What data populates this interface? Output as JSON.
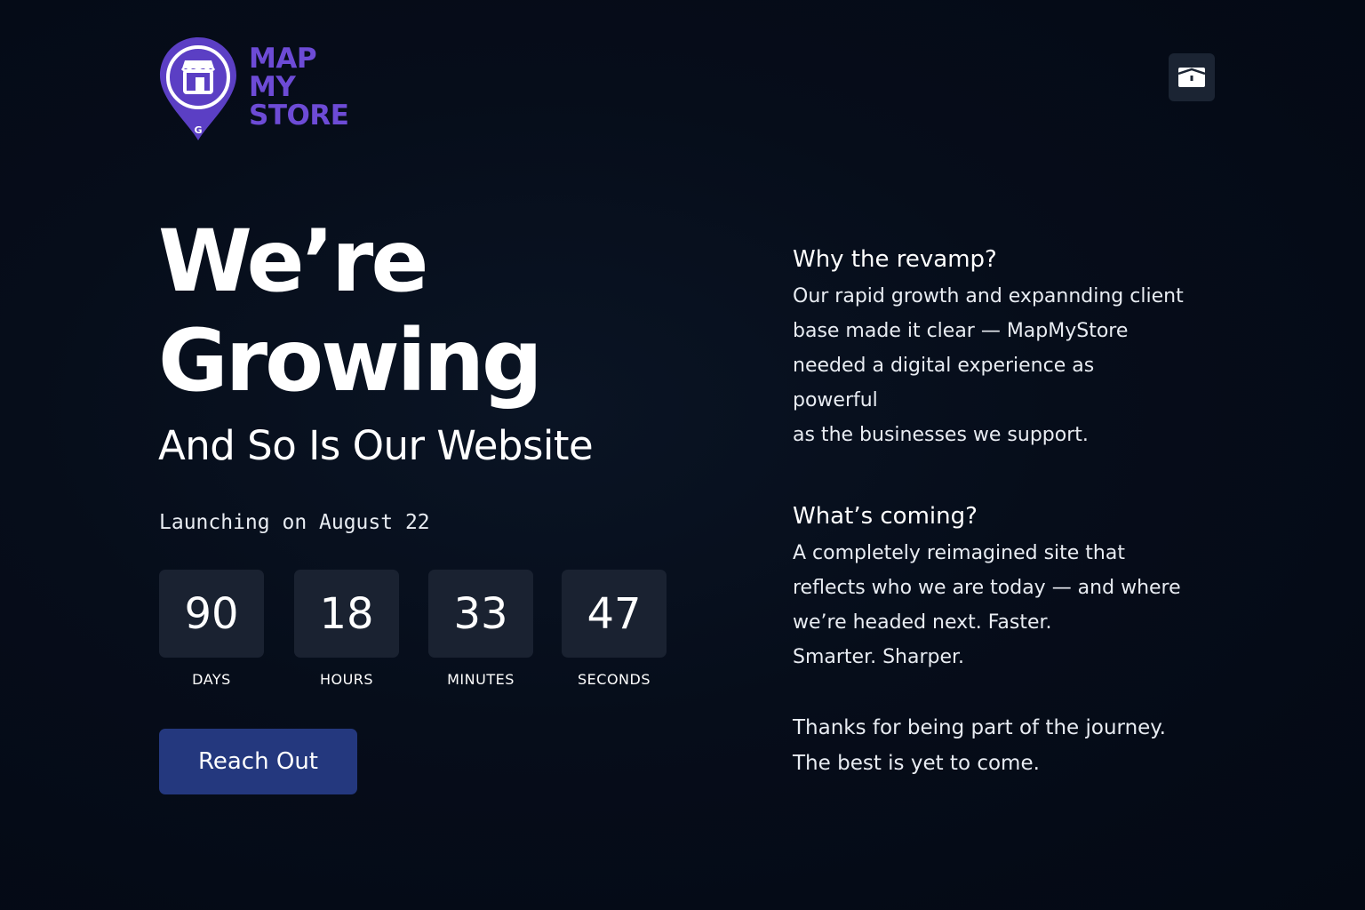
{
  "brand": {
    "lines": [
      "MAP",
      "MY",
      "STORE"
    ],
    "pin_mark": "G",
    "color": "#6d4bd6"
  },
  "header": {
    "mail_icon": "envelope-icon"
  },
  "hero": {
    "title_line1": "We’re",
    "title_line2": "Growing",
    "subtitle": "And So Is Our Website",
    "launch_text": "Launching on August 22"
  },
  "countdown": [
    {
      "value": "90",
      "label": "DAYS"
    },
    {
      "value": "18",
      "label": "HOURS"
    },
    {
      "value": "33",
      "label": "MINUTES"
    },
    {
      "value": "47",
      "label": "SECONDS"
    }
  ],
  "cta": {
    "label": "Reach Out",
    "color": "#24387e"
  },
  "info": {
    "why_heading": "Why the revamp?",
    "why_lines": [
      "Our rapid growth and expannding client",
      "base made it clear — MapMyStore",
      "needed a digital experience as powerful",
      "as the businesses we support."
    ],
    "coming_heading": "What’s coming?",
    "coming_lines": [
      "A completely reimagined site that",
      "reflects who we are today — and where",
      "we’re headed next. Faster.",
      "Smarter. Sharper."
    ],
    "thanks_lines": [
      "Thanks for being part of the journey.",
      "The best is yet to come."
    ]
  }
}
